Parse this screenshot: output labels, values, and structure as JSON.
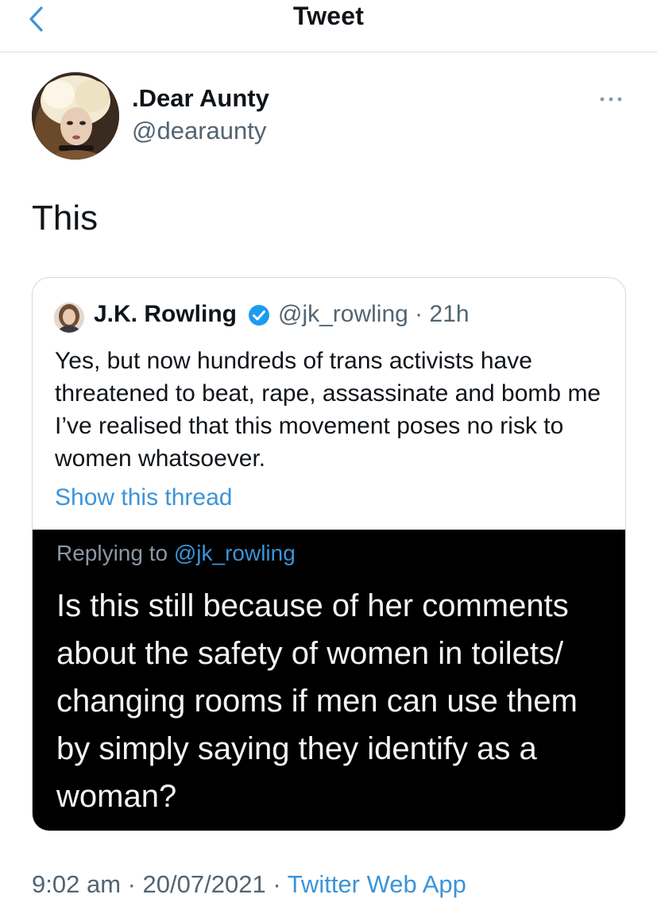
{
  "header": {
    "title": "Tweet",
    "back_icon": "chevron-left-icon"
  },
  "tweet": {
    "display_name": ".Dear Aunty",
    "handle": "@dearaunty",
    "more_icon": "more-dots-icon",
    "text": "This",
    "timestamp": "9:02 am · 20/07/2021 · ",
    "source": "Twitter Web App"
  },
  "quote": {
    "display_name": "J.K. Rowling",
    "verified_icon": "verified-badge-icon",
    "handle_time": "@jk_rowling · 21h",
    "text": "Yes, but now hundreds of trans activists have threatened to beat, rape, assassinate and bomb me I’ve realised that this movement poses no risk to women whatsoever.",
    "show_thread": "Show this thread",
    "media": {
      "replying_prefix": "Replying to ",
      "replying_handle": "@jk_rowling",
      "text": "Is this still because of her comments about the safety of women in toilets/ changing rooms if men can use them by simply saying they identify as a woman?"
    }
  },
  "colors": {
    "link": "#3b94d9",
    "secondary_text": "#536471",
    "verified": "#1d9bf0",
    "media_background": "#000000"
  }
}
